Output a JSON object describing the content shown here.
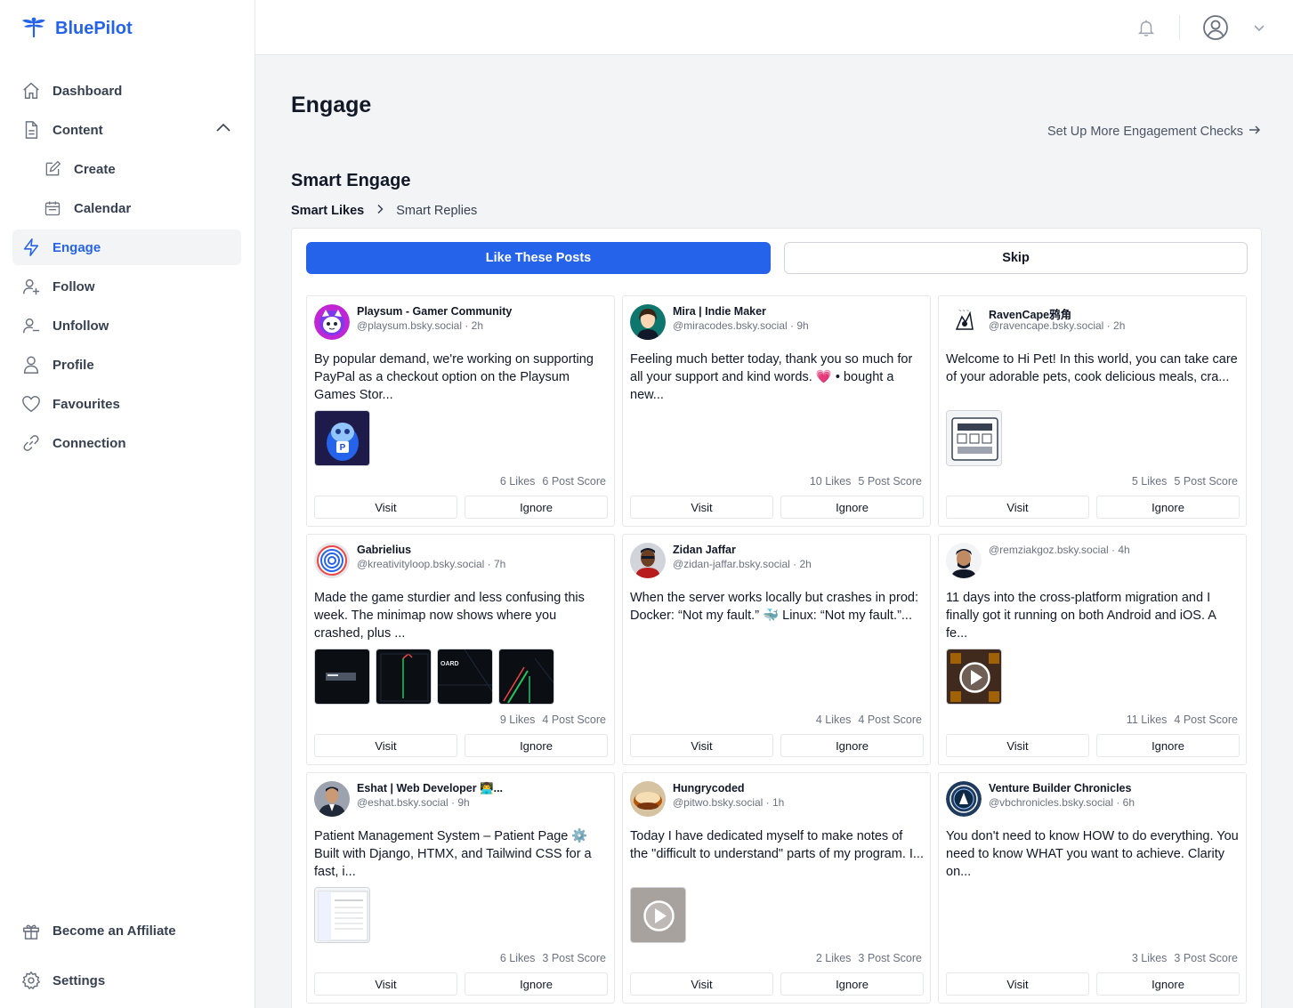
{
  "app": {
    "name": "BluePilot"
  },
  "sidebar": {
    "items": [
      {
        "label": "Dashboard",
        "icon": "home-icon"
      },
      {
        "label": "Content",
        "icon": "document-icon"
      },
      {
        "label": "Create",
        "icon": "edit-icon"
      },
      {
        "label": "Calendar",
        "icon": "calendar-icon"
      },
      {
        "label": "Engage",
        "icon": "lightning-icon"
      },
      {
        "label": "Follow",
        "icon": "user-plus-icon"
      },
      {
        "label": "Unfollow",
        "icon": "user-minus-icon"
      },
      {
        "label": "Profile",
        "icon": "user-icon"
      },
      {
        "label": "Favourites",
        "icon": "heart-icon"
      },
      {
        "label": "Connection",
        "icon": "link-icon"
      }
    ],
    "bottom": [
      {
        "label": "Become an Affiliate",
        "icon": "gift-icon"
      },
      {
        "label": "Settings",
        "icon": "gear-icon"
      }
    ]
  },
  "main": {
    "title": "Engage",
    "setup_link": "Set Up More Engagement Checks",
    "section_title": "Smart Engage",
    "breadcrumbs": [
      "Smart Likes",
      "Smart Replies"
    ],
    "like_button": "Like These Posts",
    "skip_button": "Skip",
    "visit_label": "Visit",
    "ignore_label": "Ignore"
  },
  "posts": [
    {
      "name": "Playsum - Gamer Community",
      "handle": "@playsum.bsky.social · 2h",
      "text": "By popular demand, we're working on supporting PayPal as a checkout option on the Playsum Games Stor...",
      "likes": "6 Likes",
      "score": "6 Post Score"
    },
    {
      "name": "Mira | Indie Maker",
      "handle": "@miracodes.bsky.social · 9h",
      "text": "Feeling much better today, thank you so much for all your support and kind words. 💗 • bought a new...",
      "likes": "10 Likes",
      "score": "5 Post Score"
    },
    {
      "name": "RavenCape鸦角",
      "handle": "@ravencape.bsky.social · 2h",
      "text": "Welcome to Hi Pet! In this world, you can take care of your adorable pets, cook delicious meals, cra...",
      "likes": "5 Likes",
      "score": "5 Post Score"
    },
    {
      "name": "Gabrielius",
      "handle": "@kreativityloop.bsky.social · 7h",
      "text": "Made the game sturdier and less confusing this week. The minimap now shows where you crashed, plus ...",
      "likes": "9 Likes",
      "score": "4 Post Score"
    },
    {
      "name": "Zidan Jaffar",
      "handle": "@zidan-jaffar.bsky.social · 2h",
      "text": "When the server works locally but crashes in prod: Docker: “Not my fault.” 🐳 Linux: “Not my fault.”...",
      "likes": "4 Likes",
      "score": "4 Post Score"
    },
    {
      "name": "",
      "handle": "@remziakgoz.bsky.social · 4h",
      "text": "11 days into the cross-platform migration and I finally got it running on both Android and iOS. A fe...",
      "likes": "11 Likes",
      "score": "4 Post Score"
    },
    {
      "name": "Eshat | Web Developer 👨‍💻...",
      "handle": "@eshat.bsky.social · 9h",
      "text": "Patient Management System – Patient Page ⚙️ Built with Django, HTMX, and Tailwind CSS for a fast, i...",
      "likes": "6 Likes",
      "score": "3 Post Score"
    },
    {
      "name": "Hungrycoded",
      "handle": "@pitwo.bsky.social · 1h",
      "text": "Today I have dedicated myself to make notes of the \"difficult to understand\" parts of my program. I...",
      "likes": "2 Likes",
      "score": "3 Post Score"
    },
    {
      "name": "Venture Builder Chronicles",
      "handle": "@vbchronicles.bsky.social · 6h",
      "text": "You don't need to know HOW to do everything. You need to know WHAT you want to achieve. Clarity on...",
      "likes": "3 Likes",
      "score": "3 Post Score"
    }
  ]
}
